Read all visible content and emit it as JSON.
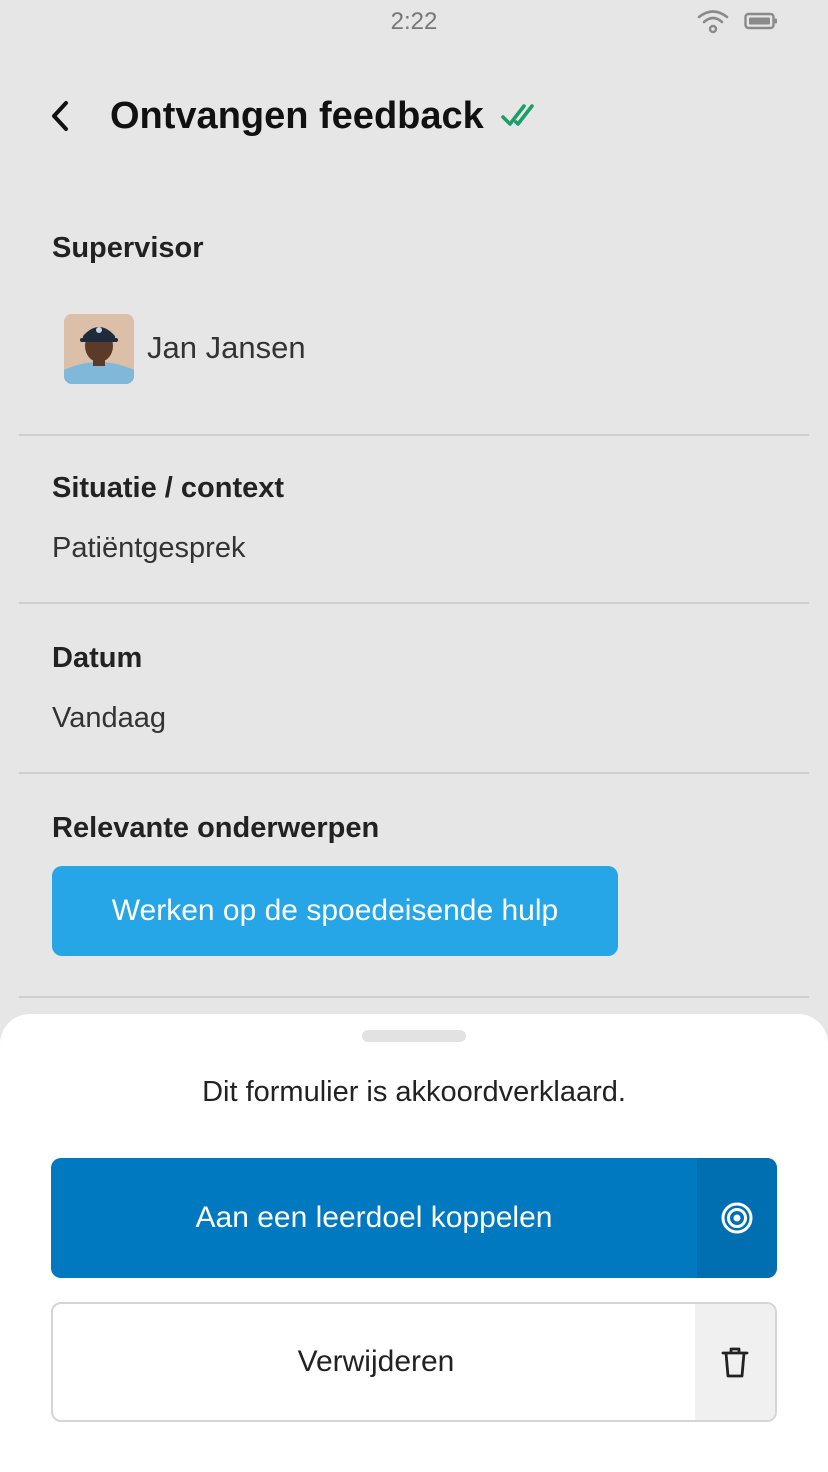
{
  "status_bar": {
    "time": "2:22",
    "wifi_icon": "wifi-icon",
    "battery_icon": "battery-icon"
  },
  "header": {
    "title": "Ontvangen feedback",
    "back_icon": "chevron-left-icon",
    "status_icon": "double-check-icon",
    "status_color": "#1a9e6a"
  },
  "supervisor": {
    "label": "Supervisor",
    "name": "Jan Jansen"
  },
  "context": {
    "label": "Situatie / context",
    "value": "Patiëntgesprek"
  },
  "date": {
    "label": "Datum",
    "value": "Vandaag"
  },
  "topics": {
    "label": "Relevante onderwerpen",
    "items": [
      "Werken op de spoedeisende hulp"
    ],
    "chip_color": "#26a6e6"
  },
  "sheet": {
    "message": "Dit formulier is akkoordverklaard.",
    "primary_button": {
      "label": "Aan een leerdoel koppelen",
      "icon": "target-icon",
      "color": "#0079c1"
    },
    "secondary_button": {
      "label": "Verwijderen",
      "icon": "trash-icon"
    }
  }
}
